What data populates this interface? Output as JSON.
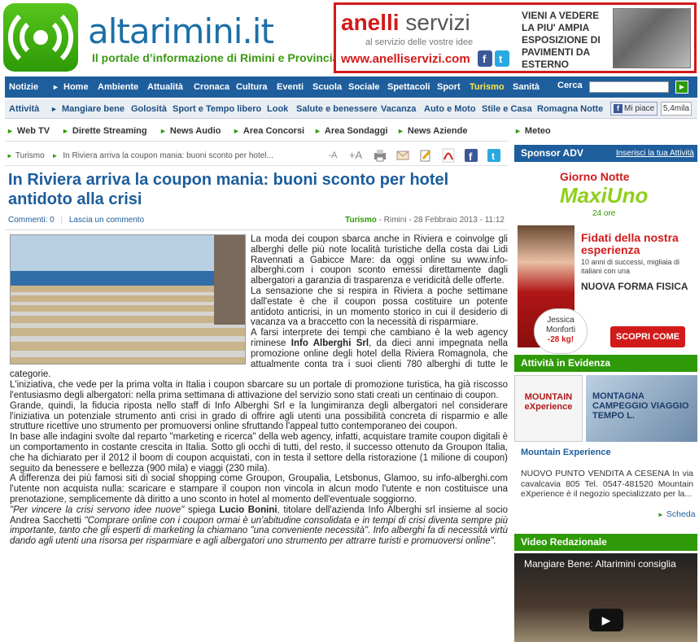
{
  "site": {
    "name": "altarimini.it",
    "tagline": "Il portale d’informazione di Rimini e Provincia"
  },
  "banner": {
    "brand": "anelli",
    "brand2": "servizi",
    "sub": "al servizio delle vostre idee",
    "url": "www.anelliservizi.com",
    "text": "VIENI A VEDERE LA PIU' AMPIA ESPOSIZIONE DI PAVIMENTI DA ESTERNO"
  },
  "nav1": [
    "Notizie",
    "Home",
    "Ambiente",
    "Attualità",
    "Cronaca",
    "Cultura",
    "Eventi",
    "Scuola",
    "Sociale",
    "Spettacoli",
    "Sport",
    "Turismo",
    "Sanità"
  ],
  "search": {
    "label": "Cerca",
    "placeholder": "",
    "button": "►"
  },
  "nav2": [
    "Attività",
    "Mangiare bene",
    "Golosità",
    "Sport e Tempo libero",
    "Look",
    "Salute e benessere",
    "Vacanza",
    "Auto e Moto",
    "Stile e Casa",
    "Romagna Notte"
  ],
  "facebook": {
    "like": "Mi piace",
    "count": "5,4mila"
  },
  "nav3": [
    "Web TV",
    "Dirette Streaming",
    "News Audio",
    "Area Concorsi",
    "Area Sondaggi",
    "News Aziende"
  ],
  "meteo": "Meteo",
  "breadcrumb": {
    "section": "Turismo",
    "sep": "►",
    "current": "In Riviera arriva la coupon mania: buoni sconto per hotel..."
  },
  "tools": {
    "font_down": "-A",
    "font_up": "+A"
  },
  "article": {
    "title": "In Riviera arriva la coupon mania: buoni sconto per hotel antidoto alla crisi",
    "comments": "Commenti: 0",
    "leave_comment": "Lascia un commento",
    "category": "Turismo",
    "place_date": " - Rimini - 28 Febbraio 2013 - 11:12",
    "p1": "La moda dei coupon sbarca anche in Riviera e coinvolge gli alberghi delle più note località turistiche della costa dai Lidi Ravennati a Gabicce Mare: da oggi online su www.info-alberghi.com i coupon sconto emessi direttamente dagli albergatori a garanzia di trasparenza e veridicità delle offerte.",
    "p2": "La sensazione che si respira in Riviera a poche settimane dall'estate è che il coupon possa costituire un potente antidoto anticrisi, in un momento storico in cui il desiderio di vacanza va a braccetto con la necessità di risparmiare.",
    "p3a": "A farsi interprete dei tempi che cambiano è la web agency riminese ",
    "p3b": "Info Alberghi Srl",
    "p3c": ", da dieci anni impegnata nella promozione online degli hotel della Riviera Romagnola, che attualmente conta tra i suoi clienti 780 alberghi di tutte le categorie.",
    "p4": "L'iniziativa, che vede per la prima volta in Italia i coupon sbarcare su un portale di promozione turistica, ha già riscosso l'entusiasmo degli albergatori: nella prima settimana di attivazione del servizio sono stati creati un centinaio di coupon.",
    "p5": "Grande, quindi, la fiducia riposta nello staff di Info Alberghi Srl e la lungimiranza degli albergatori nel considerare l'iniziativa un potenziale strumento anti crisi in grado di offrire agli utenti una possibilità concreta di risparmio e alle strutture ricettive uno strumento per promuoversi online sfruttando l'appeal tutto contemporaneo dei coupon.",
    "p6": "In base alle indagini svolte dal reparto \"marketing e ricerca\" della web agency, infatti, acquistare tramite coupon digitali è un comportamento in costante crescita in Italia. Sotto gli occhi di tutti, del resto, il successo ottenuto da Groupon Italia, che ha dichiarato per il 2012 il boom di coupon acquistati, con in testa il settore della ristorazione (1 milione di coupon) seguito da benessere e bellezza (900 mila) e viaggi (230 mila).",
    "p7": "A differenza dei più famosi siti di social shopping come Groupon, Groupalia, Letsbonus, Glamoo, su info-alberghi.com l'utente non acquista nulla: scaricare e stampare il coupon non vincola in alcun modo l'utente e non costituisce una prenotazione, semplicemente dà diritto a uno sconto in hotel al momento dell'eventuale soggiorno.",
    "p8q": "\"Per vincere la crisi servono idee nuove\"",
    "p8a": " spiega ",
    "p8b": "Lucio Bonini",
    "p8c": ", titolare dell'azienda Info Alberghi srl insieme al socio Andrea Sacchetti ",
    "p8d": "\"Comprare online con i coupon ormai è un'abitudine consolidata e in tempi di crisi diventa sempre più importante, tanto che gli esperti di marketing la chiamano \"una conveniente necessità\". Info alberghi fa di necessità virtù dando agli utenti una risorsa per risparmiare e agli albergatori uno strumento per attrarre turisti e promuoversi online\"."
  },
  "sidebar": {
    "sponsor_head": "Sponsor ADV",
    "sponsor_link": "Inserisci la tua Attività",
    "adv": {
      "brand": "Giorno Notte",
      "maxi": "MaxiUno",
      "hours": "24 ore",
      "headline": "Fidati della nostra esperienza",
      "sub": "10 anni di successi, migliaia di italiani con una",
      "nuova": "NUOVA FORMA FISICA",
      "jessica": "Jessica Monforti",
      "kg": "-28 kg!",
      "button": "SCOPRI COME ►"
    },
    "evidenza_head": "Attività in Evidenza",
    "ev_logo": "MOUNTAIN eXperience",
    "ev_photo": "MONTAGNA CAMPEGGIO VIAGGIO TEMPO L.",
    "ev_title": "Mountain Experience",
    "ev_text": "NUOVO PUNTO VENDITA A CESENA In via cavalcavia 805 Tel. 0547-481520 Mountain eXperience è il negozio specializzato per la...",
    "ev_scheda": "Scheda",
    "video_head": "Video Redazionale",
    "video_title": "Mangiare Bene: Altarimini consiglia"
  }
}
